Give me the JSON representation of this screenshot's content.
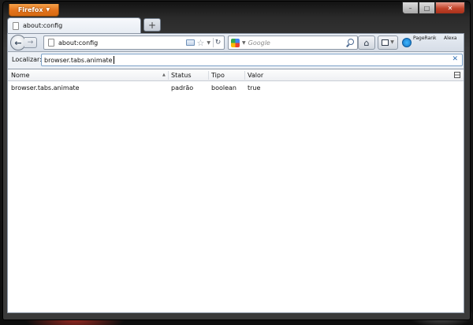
{
  "window": {
    "app_button_label": "Firefox",
    "caption": {
      "minimize": "–",
      "maximize": "□",
      "close": "✕"
    }
  },
  "tabs": [
    {
      "label": "about:config",
      "active": true
    }
  ],
  "new_tab_label": "+",
  "nav": {
    "back_glyph": "←",
    "forward_glyph": "→",
    "url": "about:config",
    "search_placeholder": "Google",
    "search_engine_icon": "google-icon",
    "home_glyph": "⌂",
    "addons": {
      "pagerank": "PageRank",
      "alexa": "Alexa"
    }
  },
  "findbar": {
    "label": "Localizar:",
    "value": "browser.tabs.animate",
    "clear_glyph": "✕"
  },
  "table": {
    "columns": [
      "Nome",
      "Status",
      "Tipo",
      "Valor"
    ],
    "rows": [
      {
        "name": "browser.tabs.animate",
        "status": "padrão",
        "type": "boolean",
        "value": "true"
      }
    ]
  },
  "colors": {
    "firefox_orange": "#e3731c",
    "close_red": "#c2432a",
    "toolbar": "#dde3eb"
  }
}
